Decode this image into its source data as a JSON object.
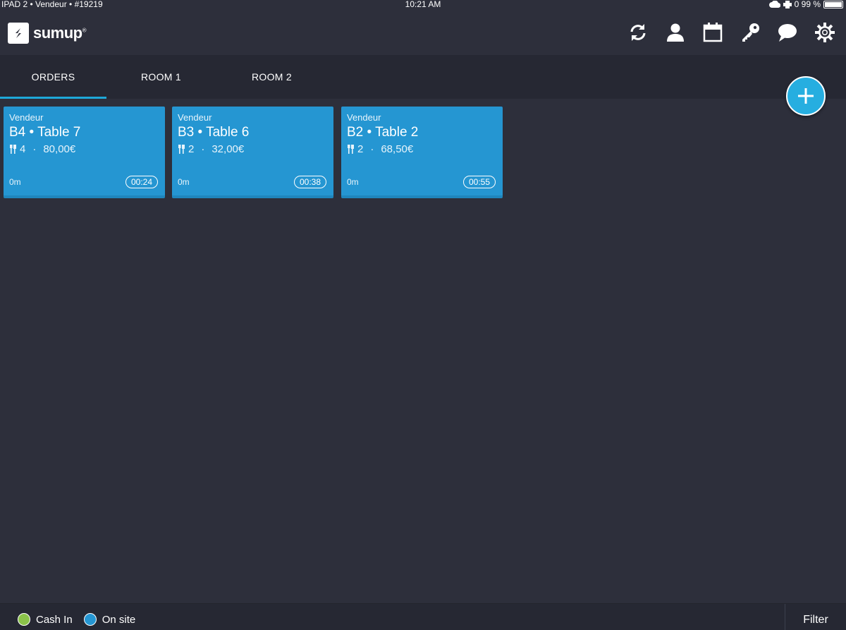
{
  "status_bar": {
    "left": "IPAD 2  •  Vendeur  •  #19219",
    "time": "10:21 AM",
    "right": "0  99 %"
  },
  "header": {
    "logo_text": "sumup",
    "icons": [
      "sync-icon",
      "user-icon",
      "calendar-icon",
      "key-icon",
      "chat-icon",
      "gear-icon"
    ]
  },
  "tabs": [
    {
      "label": "ORDERS",
      "active": true
    },
    {
      "label": "ROOM 1",
      "active": false
    },
    {
      "label": "ROOM 2",
      "active": false
    }
  ],
  "orders": [
    {
      "seller": "Vendeur",
      "title": "B4 • Table 7",
      "guests": "4",
      "amount": "80,00€",
      "elapsed": "0m",
      "timer": "00:24"
    },
    {
      "seller": "Vendeur",
      "title": "B3 • Table 6",
      "guests": "2",
      "amount": "32,00€",
      "elapsed": "0m",
      "timer": "00:38"
    },
    {
      "seller": "Vendeur",
      "title": "B2 • Table 2",
      "guests": "2",
      "amount": "68,50€",
      "elapsed": "0m",
      "timer": "00:55"
    }
  ],
  "footer": {
    "legend": [
      {
        "label": "Cash In",
        "color": "#8bc34a"
      },
      {
        "label": "On site",
        "color": "#2596d2"
      }
    ],
    "filter_label": "Filter"
  },
  "colors": {
    "background": "#2d2f3b",
    "card": "#2596d2",
    "accent": "#1ea8d8"
  }
}
